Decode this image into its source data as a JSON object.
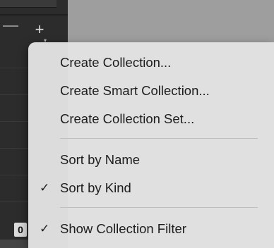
{
  "background": {
    "collection_count_badge": "0"
  },
  "menu": {
    "items": [
      {
        "label": "Create Collection...",
        "checked": false
      },
      {
        "label": "Create Smart Collection...",
        "checked": false
      },
      {
        "label": "Create Collection Set...",
        "checked": false
      },
      {
        "label": "Sort by Name",
        "checked": false
      },
      {
        "label": "Sort by Kind",
        "checked": true
      },
      {
        "label": "Show Collection Filter",
        "checked": true
      }
    ],
    "check_glyph": "✓"
  },
  "icons": [
    "plus-icon",
    "minus-icon",
    "checkmark-icon"
  ],
  "colors": {
    "menu_bg": "#e2e2e2",
    "text": "#1d1d1d",
    "panel_bg": "#2c2c2c"
  }
}
